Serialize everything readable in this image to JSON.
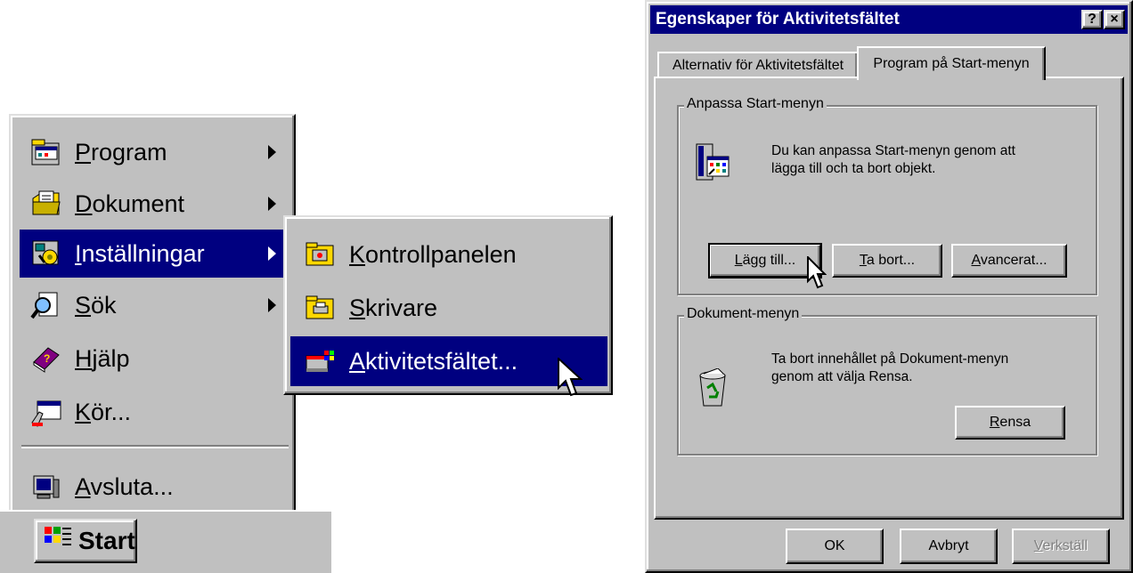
{
  "start_menu": {
    "items": [
      {
        "label": "Program",
        "accel": "P",
        "rest": "rogram",
        "submenu": true
      },
      {
        "label": "Dokument",
        "accel": "D",
        "rest": "okument",
        "submenu": true
      },
      {
        "label": "Inställningar",
        "accel": "I",
        "rest": "nställningar",
        "submenu": true,
        "selected": true
      },
      {
        "label": "Sök",
        "accel": "S",
        "rest": "ök",
        "submenu": true
      },
      {
        "label": "Hjälp",
        "accel": "H",
        "rest": "jälp",
        "submenu": false
      },
      {
        "label": "Kör...",
        "accel": "K",
        "rest": "ör...",
        "submenu": false
      },
      {
        "label": "Avsluta...",
        "accel": "A",
        "rest": "vsluta...",
        "submenu": false
      }
    ],
    "icons": [
      "programs-folder-icon",
      "documents-folder-icon",
      "settings-icon",
      "find-icon",
      "help-book-icon",
      "run-icon",
      "shutdown-icon"
    ]
  },
  "settings_submenu": {
    "items": [
      {
        "label": "Kontrollpanelen",
        "accel": "K",
        "rest": "ontrollpanelen"
      },
      {
        "label": "Skrivare",
        "accel": "S",
        "rest": "krivare"
      },
      {
        "label": "Aktivitetsfältet...",
        "accel": "A",
        "rest": "ktivitetsfältet...",
        "selected": true
      }
    ]
  },
  "taskbar": {
    "start_label": "Start"
  },
  "dialog": {
    "title": "Egenskaper för Aktivitetsfältet",
    "help_btn": "?",
    "close_btn": "×",
    "tabs": [
      {
        "label": "Alternativ för Aktivitetsfältet",
        "active": false
      },
      {
        "label": "Program på Start-menyn",
        "active": true
      }
    ],
    "group_start": {
      "title": "Anpassa Start-menyn",
      "text_line1": "Du kan anpassa Start-menyn genom att",
      "text_line2": "lägga till och ta bort objekt.",
      "buttons": {
        "add": {
          "accel": "L",
          "rest": "ägg till..."
        },
        "remove": {
          "accel": "T",
          "rest": "a bort..."
        },
        "advanced": {
          "accel": "A",
          "rest": "vancerat..."
        }
      }
    },
    "group_docs": {
      "title": "Dokument-menyn",
      "text_line1": "Ta bort innehållet på Dokument-menyn",
      "text_line2": "genom att välja Rensa.",
      "clear": {
        "accel": "R",
        "rest": "ensa"
      }
    },
    "footer": {
      "ok": "OK",
      "cancel": "Avbryt",
      "apply_accel": "V",
      "apply_rest": "erkställ"
    }
  },
  "colors": {
    "selection": "#000080",
    "face": "#c0c0c0"
  }
}
